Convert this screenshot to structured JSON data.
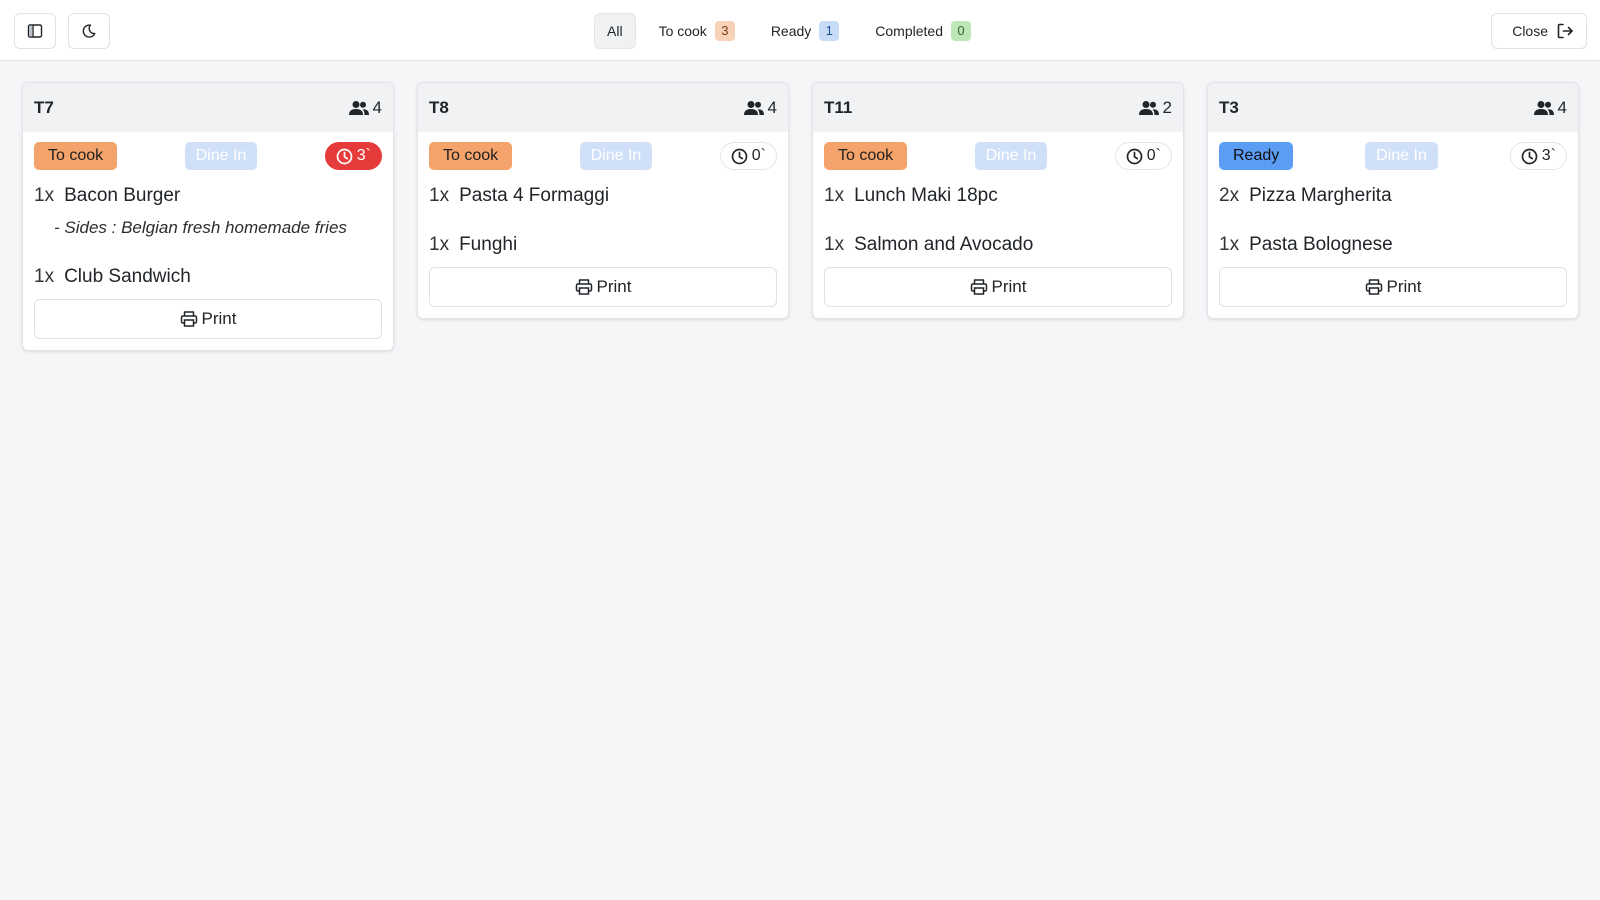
{
  "topbar": {
    "sidebar_toggle_icon": "sidebar-icon",
    "theme_toggle_icon": "moon-icon",
    "filters": [
      {
        "label": "All",
        "count": null,
        "active": true
      },
      {
        "label": "To cook",
        "count": "3",
        "badge_bg": "#f8d2b8",
        "badge_color": "#7a3d12"
      },
      {
        "label": "Ready",
        "count": "1",
        "badge_bg": "#c8dcf8",
        "badge_color": "#1d4f91"
      },
      {
        "label": "Completed",
        "count": "0",
        "badge_bg": "#bfe6b9",
        "badge_color": "#2d6b24"
      }
    ],
    "close_label": "Close",
    "close_icon": "logout-icon"
  },
  "colors": {
    "to_cook": "#f4a46a",
    "ready": "#5b9cf5",
    "dine_in": "#cfe0f8",
    "late_timer": "#e63b3b"
  },
  "orders": [
    {
      "table": "T7",
      "guests": "4",
      "status": "To cook",
      "service": "Dine In",
      "timer": "3`",
      "late": true,
      "items": [
        {
          "qty": "1x",
          "name": "Bacon Burger",
          "modifier": "- Sides : Belgian fresh homemade fries"
        },
        {
          "qty": "1x",
          "name": "Club Sandwich"
        }
      ],
      "print_label": "Print"
    },
    {
      "table": "T8",
      "guests": "4",
      "status": "To cook",
      "service": "Dine In",
      "timer": "0`",
      "late": false,
      "items": [
        {
          "qty": "1x",
          "name": "Pasta 4 Formaggi"
        },
        {
          "qty": "1x",
          "name": "Funghi"
        }
      ],
      "print_label": "Print"
    },
    {
      "table": "T11",
      "guests": "2",
      "status": "To cook",
      "service": "Dine In",
      "timer": "0`",
      "late": false,
      "items": [
        {
          "qty": "1x",
          "name": "Lunch Maki 18pc"
        },
        {
          "qty": "1x",
          "name": "Salmon and Avocado"
        }
      ],
      "print_label": "Print"
    },
    {
      "table": "T3",
      "guests": "4",
      "status": "Ready",
      "service": "Dine In",
      "timer": "3`",
      "late": false,
      "items": [
        {
          "qty": "2x",
          "name": "Pizza Margherita"
        },
        {
          "qty": "1x",
          "name": "Pasta Bolognese"
        }
      ],
      "print_label": "Print"
    }
  ]
}
